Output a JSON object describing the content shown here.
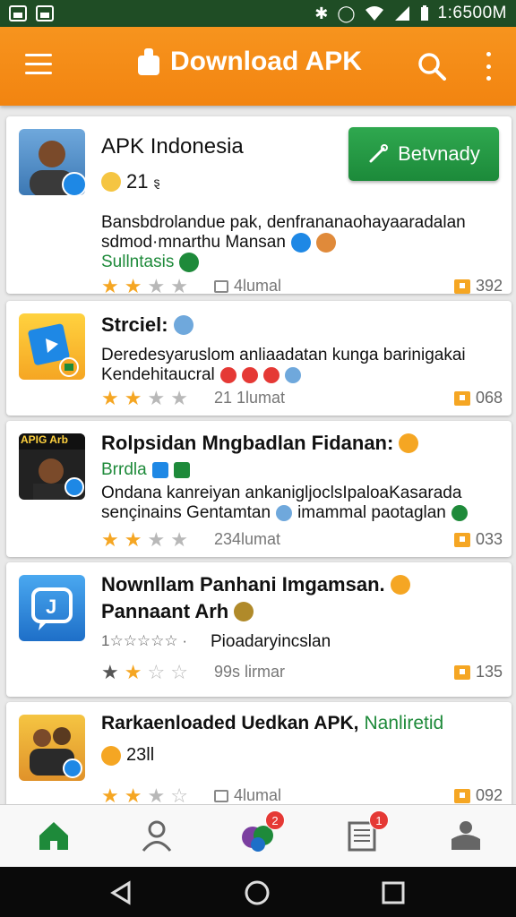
{
  "status_bar": {
    "time": "1:6500M",
    "icons": [
      "photo-icon",
      "image-icon",
      "bluetooth-icon",
      "alarm-icon",
      "wifi-icon",
      "signal-icon",
      "battery-icon"
    ]
  },
  "app_bar": {
    "title": "Download APK",
    "colors": {
      "background": "#f28410",
      "foreground": "#ffffff"
    }
  },
  "apps": [
    {
      "title": "APK Indonesia",
      "meta": "21",
      "meta_suffix": "ȿ",
      "description": "Bansbdrolandue pak, denfrananaohayaaradalan",
      "description2": "sdmod·mnarthu Mansan",
      "tag": "Sullntasis",
      "stars": 2,
      "reviews": "4lumal",
      "downloads": "392",
      "install_label": "Betvnady"
    },
    {
      "title": "Strciel:",
      "description": "Deredesyaruslom anliaadatan kunga barinigakai",
      "description2": "Kendehitaucral",
      "stars": 2,
      "reviews": "21 1lumat",
      "downloads": "068"
    },
    {
      "title": "Rolpsidan Mngbadlan Fidanan:",
      "icon_caption": "APIG Arb",
      "tag": "Brrdla",
      "description": "Ondana kanreiyan ankanigljoclsIpaloaKasarada",
      "description2": "sençinains Gentamtan",
      "description3": "imammal paotaglan",
      "stars": 2,
      "reviews": "234lumat",
      "downloads": "033"
    },
    {
      "title": "Nownllam Panhani Imgamsan.",
      "title2": "Pannaant Arh",
      "rating_text": "1☆☆☆☆☆ ·",
      "subtitle": "Pioadaryincslan",
      "stars": 1.5,
      "reviews": "99s lirmar",
      "downloads": "135"
    },
    {
      "title": "Rarkaenloaded Uedkan APK,",
      "title_tag": "Nanliretid",
      "meta": "23ll",
      "stars": 2,
      "reviews": "4lumal",
      "downloads": "092"
    }
  ],
  "bottom_nav": {
    "items": [
      {
        "name": "home",
        "badge": ""
      },
      {
        "name": "profile",
        "badge": ""
      },
      {
        "name": "chat",
        "badge": "2"
      },
      {
        "name": "news",
        "badge": "1"
      },
      {
        "name": "account",
        "badge": ""
      }
    ]
  },
  "colors": {
    "accent_orange": "#f28410",
    "install_green": "#1c8a3a",
    "star": "#f5a623",
    "badge_red": "#e53935"
  }
}
